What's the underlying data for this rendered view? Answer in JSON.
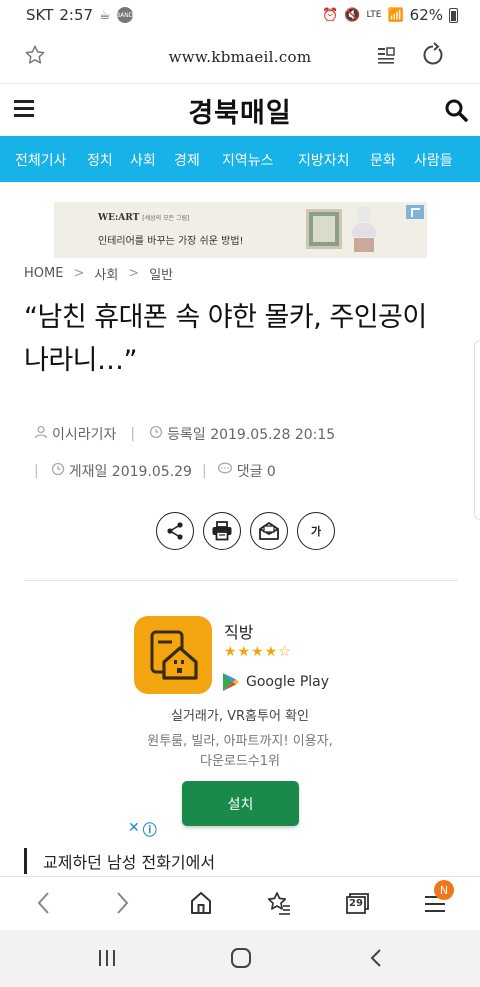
{
  "status_bar": {
    "carrier": "SKT",
    "time": "2:57",
    "band_label": "BAND",
    "network": "LTE",
    "battery": "62%"
  },
  "browser": {
    "url": "www.kbmaeil.com",
    "tab_count": "29",
    "notification_badge": "N"
  },
  "site": {
    "logo": "경북매일",
    "nav_items": [
      "전체기사",
      "정치",
      "사회",
      "경제",
      "지역뉴스",
      "지방자치",
      "문화",
      "사람들"
    ]
  },
  "top_ad": {
    "brand": "WE:ART",
    "brand_sub": "[세상의 모든 그림]",
    "tagline": "인테리어를 바꾸는 가장 쉬운 방법!"
  },
  "breadcrumb": [
    "HOME",
    "사회",
    "일반"
  ],
  "article": {
    "headline": "“남친 휴대폰 속 야한 몰카, 주인공이 나라니…”",
    "author": "이시라기자",
    "registered": "등록일 2019.05.28 20:15",
    "published": "게재일 2019.05.29",
    "comments": "댓글 0",
    "font_size_label": "가"
  },
  "app_ad": {
    "app_name": "직방",
    "rating": 4,
    "store": "Google Play",
    "line1": "실거래가, VR홈투어 확인",
    "line2": "원투룸, 빌라, 아파트까지! 이용자,",
    "line3": "다운로드수1위",
    "install": "설치",
    "colors": {
      "icon_bg": "#f3a50f",
      "button_bg": "#1a8a4c"
    }
  },
  "related": {
    "title": "교제하던 남성 전화기에서"
  },
  "colors": {
    "nav_bg": "#16b2e8",
    "accent_badge": "#f0761a"
  }
}
